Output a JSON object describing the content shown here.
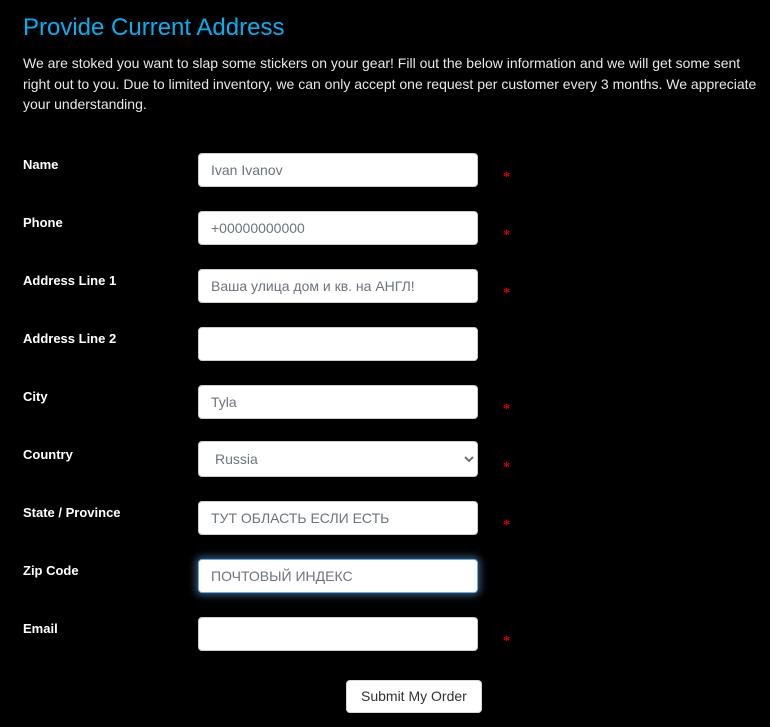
{
  "header": {
    "title": "Provide Current Address",
    "intro": "We are stoked you want to slap some stickers on your gear! Fill out the below information and we will get some sent right out to you. Due to limited inventory, we can only accept one request per customer every 3 months. We appreciate your understanding."
  },
  "colors": {
    "background": "#000000",
    "title": "#06aff0",
    "label": "#ffffff",
    "required_asterisk": "#e00000",
    "input_text": "#6d747c",
    "focus_ring": "#66afe9"
  },
  "form": {
    "required_marker": "*",
    "fields": [
      {
        "label": "Name",
        "type": "text",
        "value": "Ivan Ivanov",
        "placeholder": "Ivan Ivanov",
        "required": true,
        "focused": false
      },
      {
        "label": "Phone",
        "type": "text",
        "value": "+00000000000",
        "placeholder": "+00000000000",
        "required": true,
        "focused": false
      },
      {
        "label": "Address Line 1",
        "type": "text",
        "value": "Ваша улица дом и кв. на АНГЛ!",
        "placeholder": "Ваша улица дом и кв. на АНГЛ!",
        "required": true,
        "focused": false
      },
      {
        "label": "Address Line 2",
        "type": "text",
        "value": "",
        "placeholder": "",
        "required": false,
        "focused": false
      },
      {
        "label": "City",
        "type": "text",
        "value": "Tyla",
        "placeholder": "Tyla",
        "required": true,
        "focused": false
      },
      {
        "label": "Country",
        "type": "select",
        "value": "Russia",
        "options": [
          "Russia"
        ],
        "required": true,
        "focused": false
      },
      {
        "label": "State / Province",
        "type": "text",
        "value": "ТУТ ОБЛАСТЬ ЕСЛИ ЕСТЬ",
        "placeholder": "ТУТ ОБЛАСТЬ ЕСЛИ ЕСТЬ",
        "required": true,
        "focused": false
      },
      {
        "label": "Zip Code",
        "type": "text",
        "value": "ПОЧТОВЫЙ ИНДЕКС",
        "placeholder": "ПОЧТОВЫЙ ИНДЕКС",
        "required": false,
        "focused": true
      },
      {
        "label": "Email",
        "type": "text",
        "value": "",
        "placeholder": "",
        "required": true,
        "focused": false
      }
    ],
    "submit_label": "Submit My Order"
  }
}
